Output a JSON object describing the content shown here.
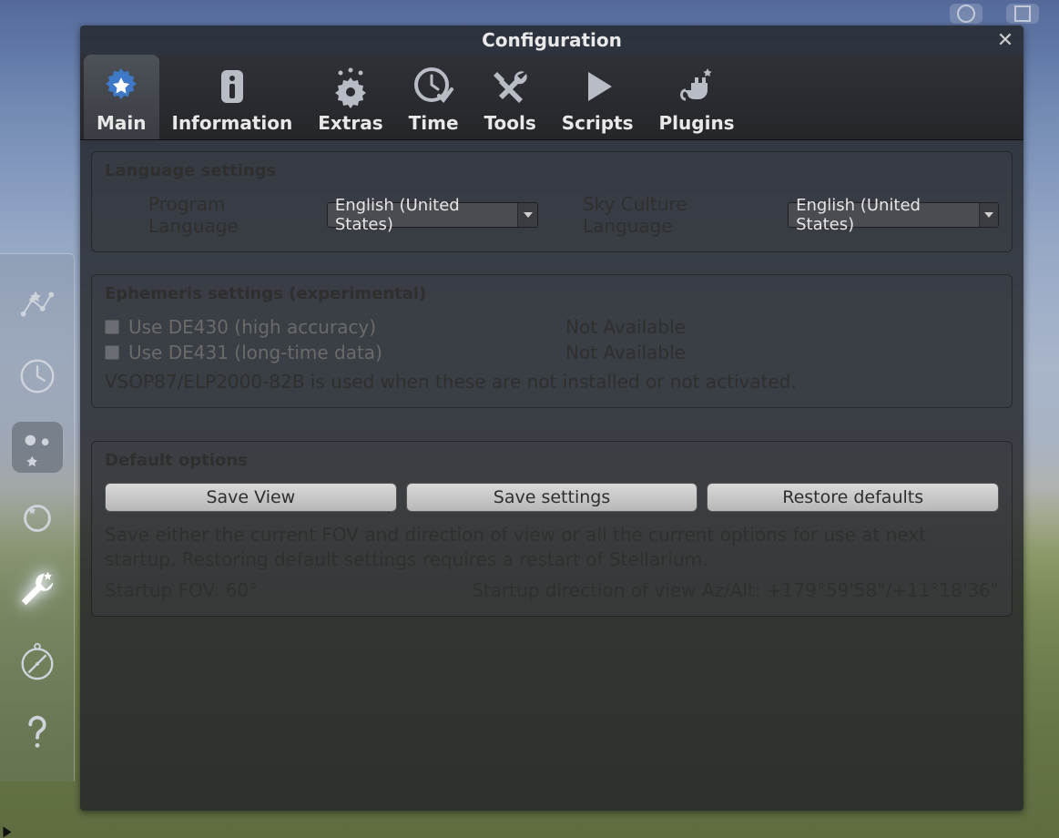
{
  "window": {
    "title": "Configuration"
  },
  "tabs": [
    {
      "id": "main",
      "label": "Main",
      "icon": "gear-star-icon",
      "active": true
    },
    {
      "id": "information",
      "label": "Information",
      "icon": "info-icon"
    },
    {
      "id": "extras",
      "label": "Extras",
      "icon": "gear-stars-icon"
    },
    {
      "id": "time",
      "label": "Time",
      "icon": "clock-check-icon"
    },
    {
      "id": "tools",
      "label": "Tools",
      "icon": "wrench-hammer-icon"
    },
    {
      "id": "scripts",
      "label": "Scripts",
      "icon": "play-icon"
    },
    {
      "id": "plugins",
      "label": "Plugins",
      "icon": "plug-star-icon"
    }
  ],
  "language": {
    "title": "Language settings",
    "program_label": "Program Language",
    "program_value": "English (United States)",
    "sky_label": "Sky Culture Language",
    "sky_value": "English (United States)"
  },
  "ephemeris": {
    "title": "Ephemeris settings (experimental)",
    "de430_label": "Use DE430 (high accuracy)",
    "de430_checked": false,
    "de430_status": "Not Available",
    "de431_label": "Use DE431 (long-time data)",
    "de431_checked": false,
    "de431_status": "Not Available",
    "note": "VSOP87/ELP2000-82B is used when these are not installed or not activated."
  },
  "defaults": {
    "title": "Default options",
    "save_view": "Save View",
    "save_settings": "Save settings",
    "restore": "Restore defaults",
    "description": "Save either the current FOV and direction of view or all the current options for use at next startup. Restoring default settings requires a restart of Stellarium.",
    "fov": "Startup FOV: 60°",
    "direction": "Startup direction of view Az/Alt: +179°59'58\"/+11°18'36\""
  },
  "sidebar_items": [
    {
      "id": "constellations",
      "icon": "constellation-icon"
    },
    {
      "id": "time",
      "icon": "clock-icon"
    },
    {
      "id": "sky-view",
      "icon": "sky-objects-icon",
      "boxed": true
    },
    {
      "id": "search",
      "icon": "target-icon"
    },
    {
      "id": "config",
      "icon": "wrench-star-icon",
      "active": true
    },
    {
      "id": "astro-calc",
      "icon": "compass-icon"
    },
    {
      "id": "help",
      "icon": "help-icon"
    }
  ]
}
